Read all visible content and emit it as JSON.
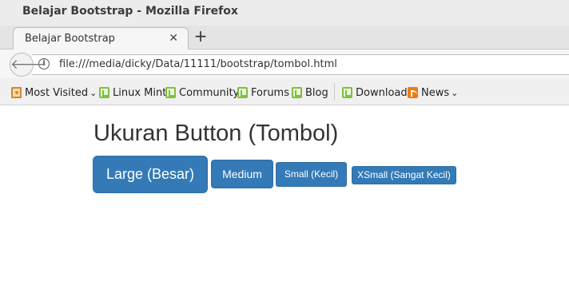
{
  "window": {
    "title": "Belajar Bootstrap - Mozilla Firefox"
  },
  "tabs": [
    {
      "label": "Belajar Bootstrap"
    }
  ],
  "navbar": {
    "url": "file:///media/dicky/Data/11111/bootstrap/tombol.html"
  },
  "bookmarks": [
    {
      "label": "Most Visited",
      "icon": "folder-icon"
    },
    {
      "label": "Linux Mint",
      "icon": "mint-icon"
    },
    {
      "label": "Community",
      "icon": "mint-icon"
    },
    {
      "label": "Forums",
      "icon": "mint-icon"
    },
    {
      "label": "Blog",
      "icon": "mint-icon"
    },
    {
      "label": "Download",
      "icon": "mint-icon"
    },
    {
      "label": "News",
      "icon": "rss-icon"
    }
  ],
  "page": {
    "heading": "Ukuran Button (Tombol)",
    "buttons": {
      "large": "Large (Besar)",
      "medium": "Medium",
      "small": "Small (Kecil)",
      "xsmall": "XSmall (Sangat Kecil)"
    }
  },
  "colors": {
    "button_primary": "#337ab7",
    "button_border": "#2e6da4"
  }
}
